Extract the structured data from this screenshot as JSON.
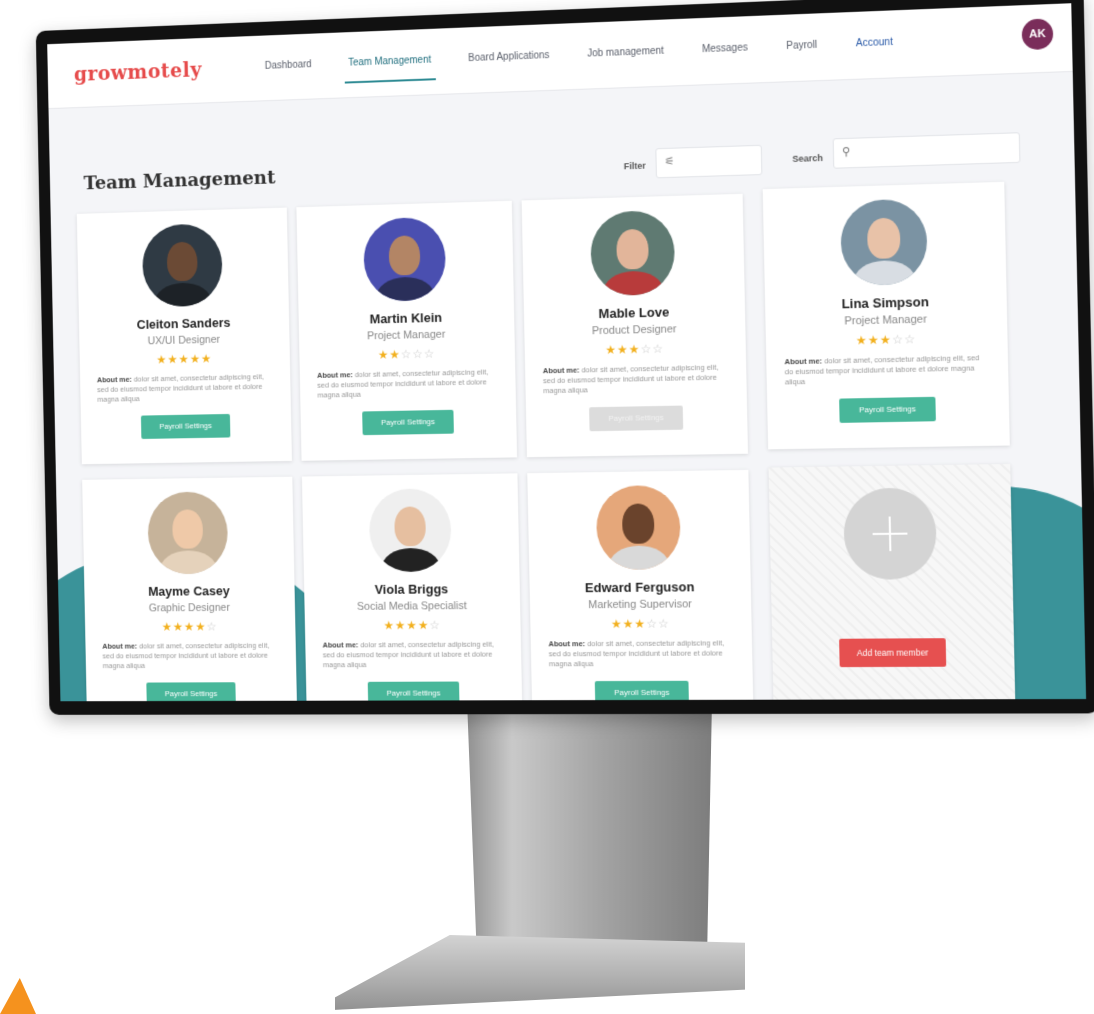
{
  "app": {
    "logo": "growmotely",
    "nav": [
      {
        "label": "Dashboard"
      },
      {
        "label": "Team Management",
        "active": true
      },
      {
        "label": "Board Applications"
      },
      {
        "label": "Job management"
      },
      {
        "label": "Messages"
      },
      {
        "label": "Payroll"
      },
      {
        "label": "Account"
      }
    ],
    "user_initials": "AK"
  },
  "page": {
    "title": "Team Management",
    "filter_label": "Filter",
    "search_label": "Search"
  },
  "members": [
    {
      "name": "Cleiton Sanders",
      "role": "UX/UI Designer",
      "rating": 5,
      "about_label": "About me:",
      "about": "dolor sit amet, consectetur adipiscing elit, sed do eiusmod tempor incididunt ut labore et dolore magna aliqua",
      "button": "Payroll Settings",
      "button_enabled": true,
      "photo_bg": "#2f3a44",
      "skin": "#6b4a35",
      "shirt": "#1d2227"
    },
    {
      "name": "Martin Klein",
      "role": "Project Manager",
      "rating": 2,
      "about_label": "About me:",
      "about": "dolor sit amet, consectetur adipiscing elit, sed do eiusmod tempor incididunt ut labore et dolore magna aliqua",
      "button": "Payroll Settings",
      "button_enabled": true,
      "photo_bg": "#4a4fb0",
      "skin": "#b38565",
      "shirt": "#2a2f5a"
    },
    {
      "name": "Mable Love",
      "role": "Product Designer",
      "rating": 3,
      "about_label": "About me:",
      "about": "dolor sit amet, consectetur adipiscing elit, sed do eiusmod tempor incididunt ut labore et dolore magna aliqua",
      "button": "Payroll Settings",
      "button_enabled": false,
      "photo_bg": "#5f7a72",
      "skin": "#e2b59a",
      "shirt": "#b83b3b"
    },
    {
      "name": "Lina Simpson",
      "role": "Project Manager",
      "rating": 3,
      "about_label": "About me:",
      "about": "dolor sit amet, consectetur adipiscing elit, sed do eiusmod tempor incididunt ut labore et dolore magna aliqua",
      "button": "Payroll Settings",
      "button_enabled": true,
      "photo_bg": "#7b93a3",
      "skin": "#e8c2a8",
      "shirt": "#d8dde3"
    },
    {
      "name": "Mayme Casey",
      "role": "Graphic Designer",
      "rating": 4,
      "about_label": "About me:",
      "about": "dolor sit amet, consectetur adipiscing elit, sed do eiusmod tempor incididunt ut labore et dolore magna aliqua",
      "button": "Payroll Settings",
      "button_enabled": true,
      "photo_bg": "#c6b39a",
      "skin": "#efc9a8",
      "shirt": "#e5d2bb"
    },
    {
      "name": "Viola Briggs",
      "role": "Social Media Specialist",
      "rating": 4,
      "about_label": "About me:",
      "about": "dolor sit amet, consectetur adipiscing elit, sed do eiusmod tempor incididunt ut labore et dolore magna aliqua",
      "button": "Payroll Settings",
      "button_enabled": true,
      "photo_bg": "#efefef",
      "skin": "#e6bfa0",
      "shirt": "#222"
    },
    {
      "name": "Edward Ferguson",
      "role": "Marketing Supervisor",
      "rating": 3,
      "about_label": "About me:",
      "about": "dolor sit amet, consectetur adipiscing elit, sed do eiusmod tempor incididunt ut labore et dolore magna aliqua",
      "button": "Payroll Settings",
      "button_enabled": true,
      "photo_bg": "#e5a77a",
      "skin": "#6a432c",
      "shirt": "#d9d9d9"
    }
  ],
  "add_member": {
    "label": "Add team member"
  },
  "colors": {
    "brand": "#e64b4b",
    "accent_teal": "#3a9399",
    "button_green": "#48b79a",
    "star": "#f2b01e",
    "add_button": "#e65050",
    "avatar": "#7a2d5a"
  },
  "icons": {
    "filter": "sliders-icon",
    "search": "search-icon",
    "add": "plus-icon"
  }
}
